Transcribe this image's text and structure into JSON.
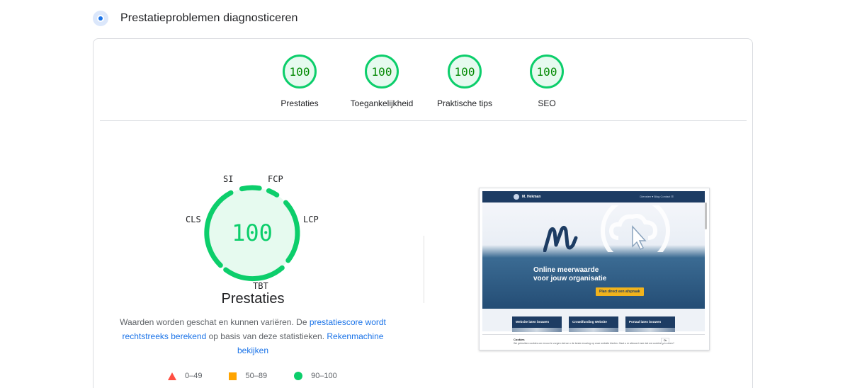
{
  "section": {
    "title": "Prestatieproblemen diagnosticeren"
  },
  "gauges": [
    {
      "score": "100",
      "label": "Prestaties"
    },
    {
      "score": "100",
      "label": "Toegankelijkheid"
    },
    {
      "score": "100",
      "label": "Praktische tips"
    },
    {
      "score": "100",
      "label": "SEO"
    }
  ],
  "performance": {
    "score": "100",
    "title": "Prestaties",
    "metrics": {
      "si": "SI",
      "fcp": "FCP",
      "lcp": "LCP",
      "tbt": "TBT",
      "cls": "CLS"
    },
    "description": {
      "part1": "Waarden worden geschat en kunnen variëren. De ",
      "link1": "prestatiescore wordt rechtstreeks berekend",
      "part2": " op basis van deze statistieken. ",
      "link2": "Rekenmachine bekijken"
    }
  },
  "legend": [
    {
      "range": "0–49",
      "icon": "red-triangle-icon",
      "color": "#ff4e42"
    },
    {
      "range": "50–89",
      "icon": "orange-square-icon",
      "color": "#ffa400"
    },
    {
      "range": "90–100",
      "icon": "green-circle-icon",
      "color": "#0cce6b"
    }
  ],
  "screenshot": {
    "site_name": "M. Hekman",
    "nav_links": "Diensten ▾   Blog   Contact   ☰",
    "headline_line1": "Online meerwaarde",
    "headline_line2": "voor jouw organisatie",
    "cta": "Plan direct een afspraak",
    "cards": [
      "Website laten bouwen",
      "Crowdfunding Website",
      "Portaal laten bouwen"
    ],
    "cookie_title": "Cookies",
    "cookie_text": "We gebruiken cookies om ervoor te zorgen dat we u de beste ervaring op onze website bieden. Gaat u er akkoord mee dat we cookies gebruiken?",
    "cookie_button": "Ok"
  },
  "colors": {
    "pass": "#0cce6b",
    "pass_text": "#008800",
    "link": "#1a73e8"
  }
}
